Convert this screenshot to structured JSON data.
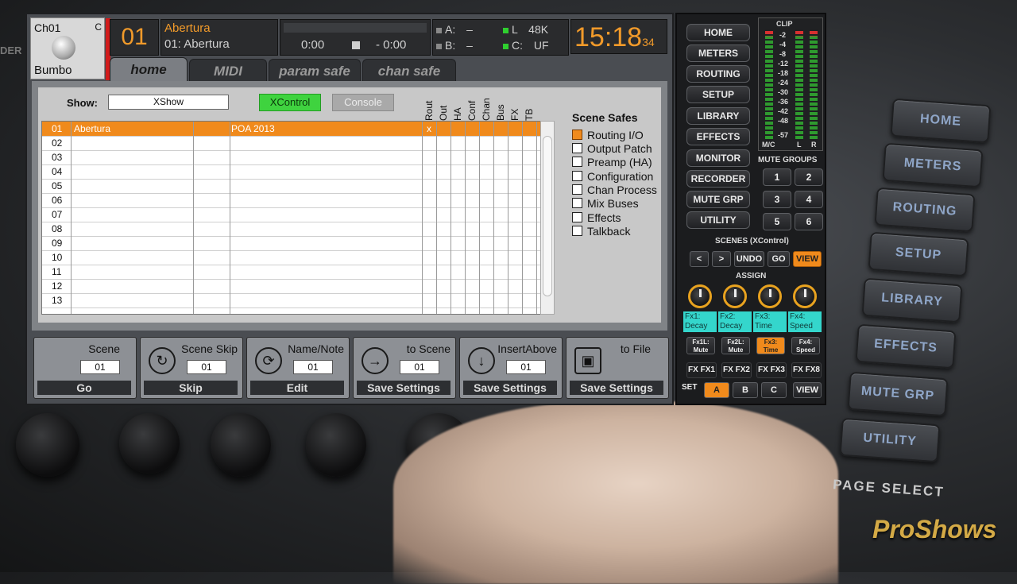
{
  "channel": {
    "id": "Ch01",
    "flag": "C",
    "name": "Bumbo"
  },
  "scene": {
    "number": "01",
    "name": "Abertura",
    "full": "01: Abertura"
  },
  "transport": {
    "elapsed": "0:00",
    "remaining": "- 0:00"
  },
  "status": {
    "a_label": "A:",
    "a_value": "–",
    "b_label": "B:",
    "b_value": "–",
    "l_label": "L",
    "l_value": "48K",
    "c_label": "C:",
    "c_value": "UF"
  },
  "clock": {
    "time": "15:18",
    "seconds": "34"
  },
  "tabs": [
    "home",
    "MIDI",
    "param safe",
    "chan safe"
  ],
  "show": {
    "label": "Show:",
    "value": "XShow"
  },
  "mode_buttons": {
    "xcontrol": "XControl",
    "console": "Console"
  },
  "columns": [
    "Rout",
    "Out",
    "HA",
    "Conf",
    "Chan",
    "Bus",
    "FX",
    "TB"
  ],
  "scene_rows": [
    {
      "num": "01",
      "name": "Abertura",
      "note": "POA 2013",
      "mark": "x"
    },
    {
      "num": "02",
      "name": "",
      "note": "",
      "mark": ""
    },
    {
      "num": "03",
      "name": "",
      "note": "",
      "mark": ""
    },
    {
      "num": "04",
      "name": "",
      "note": "",
      "mark": ""
    },
    {
      "num": "05",
      "name": "",
      "note": "",
      "mark": ""
    },
    {
      "num": "06",
      "name": "",
      "note": "",
      "mark": ""
    },
    {
      "num": "07",
      "name": "",
      "note": "",
      "mark": ""
    },
    {
      "num": "08",
      "name": "",
      "note": "",
      "mark": ""
    },
    {
      "num": "09",
      "name": "",
      "note": "",
      "mark": ""
    },
    {
      "num": "10",
      "name": "",
      "note": "",
      "mark": ""
    },
    {
      "num": "11",
      "name": "",
      "note": "",
      "mark": ""
    },
    {
      "num": "12",
      "name": "",
      "note": "",
      "mark": ""
    },
    {
      "num": "13",
      "name": "",
      "note": "",
      "mark": ""
    }
  ],
  "scene_safes": {
    "title": "Scene Safes",
    "items": [
      {
        "label": "Routing I/O",
        "checked": true
      },
      {
        "label": "Output Patch",
        "checked": false
      },
      {
        "label": "Preamp (HA)",
        "checked": false
      },
      {
        "label": "Configuration",
        "checked": false
      },
      {
        "label": "Chan Process",
        "checked": false
      },
      {
        "label": "Mix Buses",
        "checked": false
      },
      {
        "label": "Effects",
        "checked": false
      },
      {
        "label": "Talkback",
        "checked": false
      }
    ]
  },
  "bottom_actions": [
    {
      "title": "Scene",
      "value": "01",
      "action": "Go",
      "icon": ""
    },
    {
      "title": "Scene Skip",
      "value": "01",
      "action": "Skip",
      "icon": "skip-icon"
    },
    {
      "title": "Name/Note",
      "value": "01",
      "action": "Edit",
      "icon": "refresh-icon"
    },
    {
      "title": "to Scene",
      "value": "01",
      "action": "Save Settings",
      "icon": "arrow-right-icon"
    },
    {
      "title": "InsertAbove",
      "value": "01",
      "action": "Save Settings",
      "icon": "arrow-down-icon"
    },
    {
      "title": "to File",
      "value": "",
      "action": "Save Settings",
      "icon": "save-file-icon"
    }
  ],
  "nav_buttons": [
    "HOME",
    "METERS",
    "ROUTING",
    "SETUP",
    "LIBRARY",
    "EFFECTS",
    "MONITOR",
    "RECORDER",
    "MUTE GRP",
    "UTILITY"
  ],
  "meter": {
    "clip": "CLIP",
    "scale": [
      "-2",
      "-4",
      "-8",
      "-12",
      "-18",
      "-24",
      "-30",
      "-36",
      "-42",
      "-48",
      "-57"
    ],
    "mc": "M/C",
    "l": "L",
    "r": "R"
  },
  "mute_groups": {
    "title": "MUTE GROUPS",
    "items": [
      "1",
      "2",
      "3",
      "4",
      "5",
      "6"
    ]
  },
  "scenes_ctrl": {
    "title": "SCENES (XControl)",
    "prev": "<",
    "next": ">",
    "undo": "UNDO",
    "go": "GO",
    "view": "VIEW"
  },
  "assign": {
    "title": "ASSIGN",
    "labels": [
      "Fx1: Decay",
      "Fx2: Decay",
      "Fx3: Time",
      "Fx4: Speed"
    ],
    "buttons": [
      "Fx1L: Mute",
      "Fx2L: Mute",
      "Fx3: Time",
      "Fx4: Speed"
    ],
    "fx_buttons": [
      "FX FX1",
      "FX FX2",
      "FX FX3",
      "FX FX8"
    ],
    "set": "SET",
    "sets": [
      "A",
      "B",
      "C"
    ],
    "view": "VIEW"
  },
  "hardware": {
    "keys": [
      "HOME",
      "METERS",
      "ROUTING",
      "SETUP",
      "LIBRARY",
      "EFFECTS",
      "MUTE GRP",
      "UTILITY"
    ],
    "page_select": "PAGE SELECT",
    "edge_text": "DER"
  },
  "watermark": "ProShows",
  "colors": {
    "accent": "#f08a1c",
    "xcontrol": "#3fd33f",
    "assign": "#34d6cc"
  }
}
